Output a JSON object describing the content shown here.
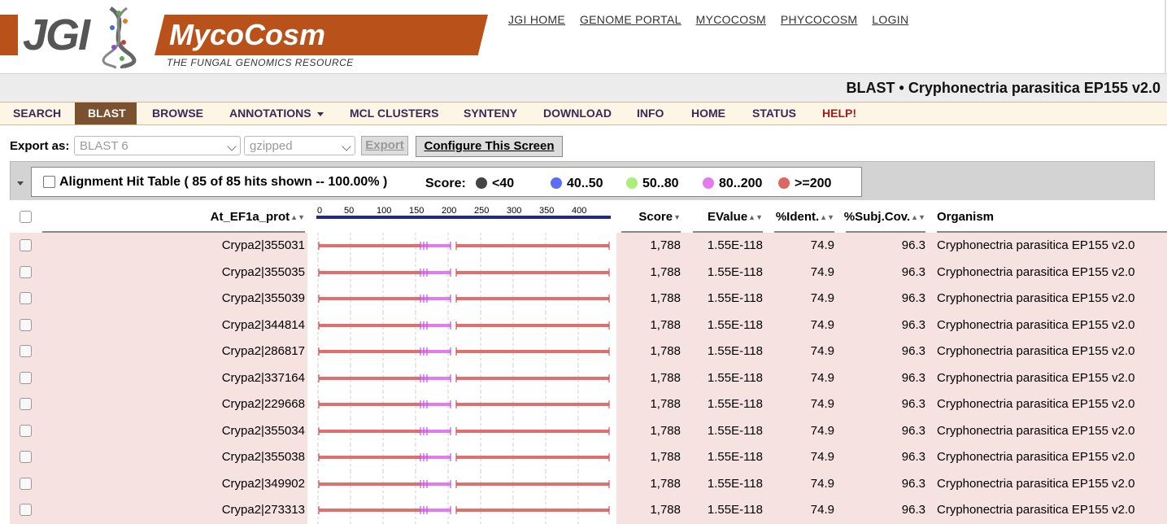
{
  "brand": {
    "jgi": "JGI",
    "mycocosm": "MycoCosm",
    "tagline": "THE FUNGAL GENOMICS RESOURCE"
  },
  "top_links": [
    "JGI HOME",
    "GENOME PORTAL",
    "MYCOCOSM",
    "PHYCOCOSM",
    "LOGIN"
  ],
  "page_title": "BLAST • Cryphonectria parasitica EP155 v2.0",
  "nav": [
    {
      "label": "SEARCH"
    },
    {
      "label": "BLAST",
      "active": true
    },
    {
      "label": "BROWSE"
    },
    {
      "label": "ANNOTATIONS",
      "dropdown": true
    },
    {
      "label": "MCL CLUSTERS"
    },
    {
      "label": "SYNTENY"
    },
    {
      "label": "DOWNLOAD"
    },
    {
      "label": "INFO"
    },
    {
      "label": "HOME"
    },
    {
      "label": "STATUS"
    },
    {
      "label": "HELP!",
      "highlight": true
    }
  ],
  "export": {
    "label": "Export as:",
    "format": "BLAST 6",
    "compression": "gzipped",
    "export_button": "Export",
    "configure_button": "Configure This Screen"
  },
  "hit_table": {
    "title": "Alignment Hit Table ( 85  of 85  hits shown -- 100.00%  )",
    "score_label": "Score:",
    "legend": [
      {
        "label": "<40",
        "color": "#444444"
      },
      {
        "label": "40..50",
        "color": "#5b6ef5"
      },
      {
        "label": "50..80",
        "color": "#a8f07a"
      },
      {
        "label": "80..200",
        "color": "#e37af0"
      },
      {
        "label": ">=200",
        "color": "#e06666"
      }
    ]
  },
  "columns": {
    "query": "At_EF1a_prot",
    "score": "Score",
    "evalue": "EValue",
    "ident": "%Ident.",
    "subjcov": "%Subj.Cov.",
    "organism": "Organism"
  },
  "scale_ticks": [
    "0",
    "50",
    "100",
    "150",
    "200",
    "250",
    "300",
    "350",
    "400"
  ],
  "rows": [
    {
      "id": "Crypa2|355031",
      "score": "1,788",
      "evalue": "1.55E-118",
      "ident": "74.9",
      "subjcov": "96.3",
      "organism": "Cryphonectria parasitica EP155 v2.0"
    },
    {
      "id": "Crypa2|355035",
      "score": "1,788",
      "evalue": "1.55E-118",
      "ident": "74.9",
      "subjcov": "96.3",
      "organism": "Cryphonectria parasitica EP155 v2.0"
    },
    {
      "id": "Crypa2|355039",
      "score": "1,788",
      "evalue": "1.55E-118",
      "ident": "74.9",
      "subjcov": "96.3",
      "organism": "Cryphonectria parasitica EP155 v2.0"
    },
    {
      "id": "Crypa2|344814",
      "score": "1,788",
      "evalue": "1.55E-118",
      "ident": "74.9",
      "subjcov": "96.3",
      "organism": "Cryphonectria parasitica EP155 v2.0"
    },
    {
      "id": "Crypa2|286817",
      "score": "1,788",
      "evalue": "1.55E-118",
      "ident": "74.9",
      "subjcov": "96.3",
      "organism": "Cryphonectria parasitica EP155 v2.0"
    },
    {
      "id": "Crypa2|337164",
      "score": "1,788",
      "evalue": "1.55E-118",
      "ident": "74.9",
      "subjcov": "96.3",
      "organism": "Cryphonectria parasitica EP155 v2.0"
    },
    {
      "id": "Crypa2|229668",
      "score": "1,788",
      "evalue": "1.55E-118",
      "ident": "74.9",
      "subjcov": "96.3",
      "organism": "Cryphonectria parasitica EP155 v2.0"
    },
    {
      "id": "Crypa2|355034",
      "score": "1,788",
      "evalue": "1.55E-118",
      "ident": "74.9",
      "subjcov": "96.3",
      "organism": "Cryphonectria parasitica EP155 v2.0"
    },
    {
      "id": "Crypa2|355038",
      "score": "1,788",
      "evalue": "1.55E-118",
      "ident": "74.9",
      "subjcov": "96.3",
      "organism": "Cryphonectria parasitica EP155 v2.0"
    },
    {
      "id": "Crypa2|349902",
      "score": "1,788",
      "evalue": "1.55E-118",
      "ident": "74.9",
      "subjcov": "96.3",
      "organism": "Cryphonectria parasitica EP155 v2.0"
    },
    {
      "id": "Crypa2|273313",
      "score": "1,788",
      "evalue": "1.55E-118",
      "ident": "74.9",
      "subjcov": "96.3",
      "organism": "Cryphonectria parasitica EP155 v2.0"
    }
  ],
  "colors": {
    "brand_orange": "#b8521a",
    "nav_active": "#7a5230",
    "row_pink": "#f6e2e1",
    "hit_bar": "#e07070",
    "hit_gap": "#e37af0",
    "query_bar": "#1f2a8a"
  }
}
